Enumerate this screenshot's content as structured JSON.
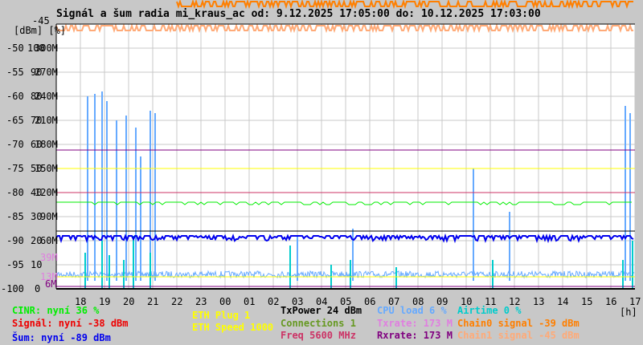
{
  "chart_data": {
    "type": "line",
    "title": "Signál a šum radia mi_kraus_ac od: 9.12.2025 17:05:00 do: 10.12.2025 17:03:00",
    "axis_units": {
      "dbm": "[dBm]",
      "pct": "[%]",
      "hours": "[h]"
    },
    "y_dbm": {
      "range": [
        -100,
        -45
      ],
      "ticks": [
        "-45",
        "-50",
        "-55",
        "-60",
        "-65",
        "-70",
        "-75",
        "-80",
        "-85",
        "-90",
        "-95",
        "-100"
      ]
    },
    "y_pct": {
      "range": [
        0,
        100
      ],
      "ticks": [
        "100",
        "90",
        "80",
        "70",
        "60",
        "50",
        "40",
        "30",
        "20",
        "10",
        "0"
      ]
    },
    "y_rate": {
      "range": [
        0,
        300
      ],
      "ticks": [
        "300M",
        "270M",
        "240M",
        "210M",
        "180M",
        "150M",
        "120M",
        "90M",
        "60M"
      ],
      "extra_ticks": [
        {
          "label": "39M",
          "color": "#e07ee0"
        },
        {
          "label": "13M",
          "color": "#e07ee0"
        },
        {
          "label": "6M",
          "color": "#800080"
        }
      ]
    },
    "x": {
      "range_hours": [
        17,
        41
      ],
      "ticks": [
        "18",
        "19",
        "20",
        "21",
        "22",
        "23",
        "00",
        "01",
        "02",
        "03",
        "04",
        "05",
        "06",
        "07",
        "08",
        "09",
        "10",
        "11",
        "12",
        "13",
        "14",
        "15",
        "16",
        "17"
      ]
    },
    "grid": true,
    "series": [
      {
        "name": "Chain0 signal",
        "unit": "dBm",
        "color": "#ff7f00",
        "current": -39
      },
      {
        "name": "Chain1 signal",
        "unit": "dBm",
        "color": "#ffaa77",
        "current": -45
      },
      {
        "name": "Šum",
        "unit": "dBm",
        "color": "#0000ee",
        "current": -89
      },
      {
        "name": "CINR",
        "unit": "%",
        "color": "#00ee00",
        "current": 36
      },
      {
        "name": "TxPower",
        "unit": "%",
        "color": "#000000",
        "current": 24
      },
      {
        "name": "Rxrate",
        "unit": "M",
        "color": "#800080",
        "current": 173
      },
      {
        "name": "Txrate",
        "unit": "M",
        "color": "#e07ee0",
        "current": 173
      },
      {
        "name": "ETH Speed",
        "unit": "%",
        "color": "#ffff00",
        "current": 50
      },
      {
        "name": "Freq",
        "unit": "%",
        "color": "#cc3366",
        "current": 40
      },
      {
        "name": "CPU load",
        "unit": "%",
        "color": "#66aaff",
        "current": 6,
        "spikes_hours": [
          [
            18.3,
            80
          ],
          [
            18.6,
            81
          ],
          [
            18.9,
            82
          ],
          [
            19.1,
            78
          ],
          [
            19.5,
            70
          ],
          [
            19.9,
            72
          ],
          [
            20.3,
            67
          ],
          [
            20.5,
            55
          ],
          [
            20.9,
            74
          ],
          [
            21.1,
            73
          ],
          [
            27.0,
            22
          ],
          [
            29.3,
            25
          ],
          [
            34.3,
            50
          ],
          [
            35.8,
            32
          ],
          [
            40.6,
            76
          ],
          [
            40.8,
            73
          ]
        ]
      },
      {
        "name": "Airtime",
        "unit": "%",
        "color": "#00cccc",
        "current": 0,
        "spikes_hours": [
          [
            18.2,
            15
          ],
          [
            18.9,
            20
          ],
          [
            19.2,
            14
          ],
          [
            19.8,
            12
          ],
          [
            20.2,
            22
          ],
          [
            20.9,
            15
          ],
          [
            26.7,
            18
          ],
          [
            28.4,
            10
          ],
          [
            29.2,
            12
          ],
          [
            31.1,
            9
          ],
          [
            35.1,
            12
          ],
          [
            40.5,
            12
          ],
          [
            40.9,
            20
          ]
        ]
      }
    ]
  },
  "legend": {
    "cinr": "CINR: nyní 36 %",
    "signal": "Signál: nyní -38 dBm",
    "noise": "Šum: nyní -89 dBm",
    "eth_plug": "ETH Plug 1",
    "eth_speed": "ETH Speed 1000",
    "txpower": "TxPower 24 dBm",
    "connections": "Connections 1",
    "freq": "Freq 5600 MHz",
    "cpu": "CPU load 6 %",
    "txrate": "Txrate: 173 M",
    "rxrate": "Rxrate: 173 M",
    "airtime": "Airtime 0 %",
    "chain0": "Chain0 signal -39 dBm",
    "chain1": "Chain1 signal -45 dBm"
  }
}
